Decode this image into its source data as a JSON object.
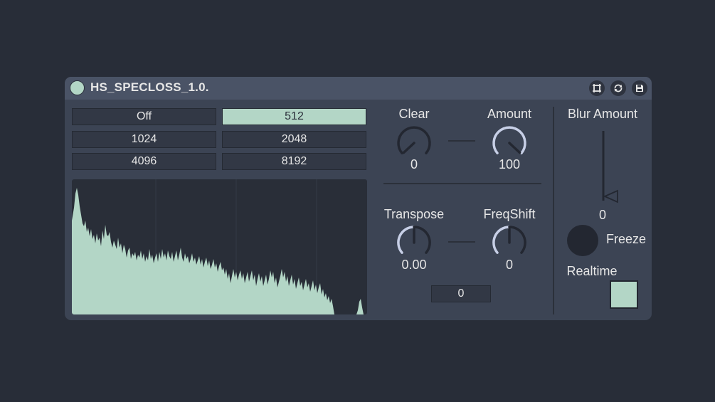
{
  "device": {
    "title": "HS_SPECLOSS_1.0.",
    "power_on": true
  },
  "icons": [
    "power-icon",
    "freeze-icon",
    "sync-icon",
    "save-icon"
  ],
  "size_buttons": [
    {
      "label": "Off",
      "active": false
    },
    {
      "label": "512",
      "active": true
    },
    {
      "label": "1024",
      "active": false
    },
    {
      "label": "2048",
      "active": false
    },
    {
      "label": "4096",
      "active": false
    },
    {
      "label": "8192",
      "active": false
    }
  ],
  "knobs": {
    "clear": {
      "label": "Clear",
      "value": "0"
    },
    "amount": {
      "label": "Amount",
      "value": "100"
    },
    "transpose": {
      "label": "Transpose",
      "value": "0.00"
    },
    "freqshift": {
      "label": "FreqShift",
      "value": "0"
    }
  },
  "number_box": {
    "value": "0"
  },
  "blur": {
    "label": "Blur Amount",
    "value": "0"
  },
  "freeze": {
    "label": "Freeze"
  },
  "realtime": {
    "label": "Realtime",
    "checked": true
  },
  "colors": {
    "background": "#282d38",
    "panel": "#3c4454",
    "titlebar": "#4a5366",
    "accent": "#b3d6c6",
    "dark": "#292e38",
    "text": "#e6e6e6"
  }
}
